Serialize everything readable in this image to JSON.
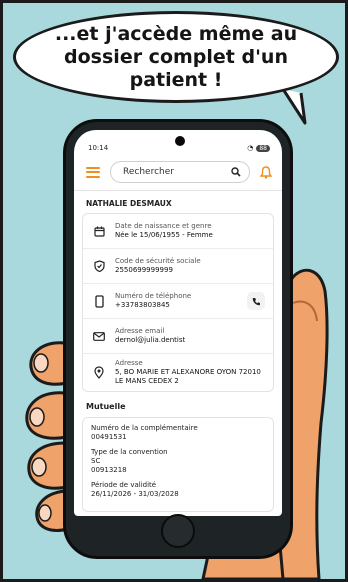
{
  "caption": "...et j'accède même au dossier complet d'un patient !",
  "status_bar": {
    "time": "10:14",
    "battery": "88"
  },
  "header": {
    "search_placeholder": "Rechercher"
  },
  "patient": {
    "name": "NATHALIE DESMAUX",
    "fields": [
      {
        "icon": "calendar-icon",
        "label": "Date de naissance et genre",
        "value": "Née le 15/06/1955 - Femme"
      },
      {
        "icon": "shield-icon",
        "label": "Code de sécurité sociale",
        "value": "2550699999999"
      },
      {
        "icon": "phone-icon",
        "label": "Numéro de téléphone",
        "value": "+33783803845"
      },
      {
        "icon": "email-icon",
        "label": "Adresse email",
        "value": "dernol@julia.dentist"
      },
      {
        "icon": "location-pin-icon",
        "label": "Adresse",
        "value": "5, BO MARIE ET ALEXANORE OYON 72010",
        "value2": "LE MANS CEDEX 2"
      }
    ]
  },
  "mutuelle": {
    "title": "Mutuelle",
    "complementary_label": "Numéro de la complémentaire",
    "complementary_value": "00491531",
    "convention_label": "Type de la convention",
    "convention_value": "SC",
    "convention_code": "00913218",
    "validity_label": "Période de validité",
    "validity_value": "26/11/2026 - 31/03/2028"
  },
  "colors": {
    "accent": "#ef8f1f",
    "background": "#a9d9dc",
    "skin": "#efa36a"
  }
}
